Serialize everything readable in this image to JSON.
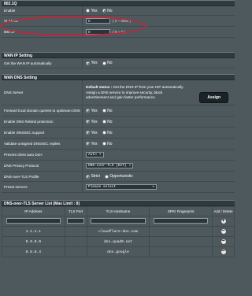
{
  "top_section": {
    "header": "802.1Q"
  },
  "rows_8021q": [
    {
      "label": "Enable",
      "type": "radio",
      "options": [
        "Yes",
        "No"
      ],
      "selected": 1
    },
    {
      "label": "VLAN ID",
      "type": "input",
      "value": "0",
      "hint": "( 2 ~ 4094 )"
    },
    {
      "label": "802.1P",
      "type": "input",
      "value": "0",
      "hint": "( 0 ~ 7 )"
    }
  ],
  "wan_ip": {
    "header": "WAN IP Setting",
    "label": "Get the WAN IP automatically",
    "options": [
      "Yes",
      "No"
    ],
    "selected": 0
  },
  "wan_dns": {
    "header": "WAN DNS Setting",
    "dns_server": {
      "label": "DNS Server",
      "status_prefix": "Default status : ",
      "status_text": "Get the DNS IP from your ISP automatically.",
      "description": "Assign a DNS service to improve security, block advertisement and gain faster performance.",
      "button": "Assign"
    },
    "rows": [
      {
        "label": "Forward local domain queries to upstream DNS",
        "options": [
          "Yes",
          "No"
        ],
        "selected": 0
      },
      {
        "label": "Enable DNS Rebind protection",
        "options": [
          "Yes",
          "No"
        ],
        "selected": 0
      },
      {
        "label": "Enable DNSSEC support",
        "options": [
          "Yes",
          "No"
        ],
        "selected": 0
      },
      {
        "label": "Validate unsigned DNSSEC replies",
        "options": [
          "Yes",
          "No"
        ],
        "selected": 0
      }
    ],
    "prevent_doh": {
      "label": "Prevent client auto DoH",
      "value": "Auto"
    },
    "privacy": {
      "label": "DNS Privacy Protocol",
      "value": "DNS-over-TLS (DoT)"
    },
    "tls_profile": {
      "label": "DNS-over-TLS Profile",
      "options": [
        "Strict",
        "Opportunistic"
      ],
      "selected": 0
    },
    "preset": {
      "label": "Preset servers",
      "value": "Please select"
    }
  },
  "dot_list": {
    "header": "DNS-over-TLS Server List (Max Limit : 8)",
    "columns": [
      "IP Address",
      "TLS Port",
      "TLS Hostname",
      "SPKI Fingerprint",
      "Add / Delete"
    ],
    "rows": [
      {
        "ip": "1.1.1.1",
        "port": "",
        "hostname": "cloudflare-dns.com",
        "spki": ""
      },
      {
        "ip": "9.9.9.9",
        "port": "",
        "hostname": "dns.quad9.net",
        "spki": ""
      },
      {
        "ip": "8.8.8.4",
        "port": "",
        "hostname": "dns.google",
        "spki": ""
      }
    ],
    "add_symbol": "+",
    "delete_symbol": "−"
  },
  "icons": {
    "dropdown": "chevron-down-icon",
    "add": "plus-circle-icon",
    "delete": "minus-circle-icon"
  },
  "colors": {
    "background": "#4d595d",
    "header": "#2f3a3e",
    "highlight": "#c7243a"
  }
}
